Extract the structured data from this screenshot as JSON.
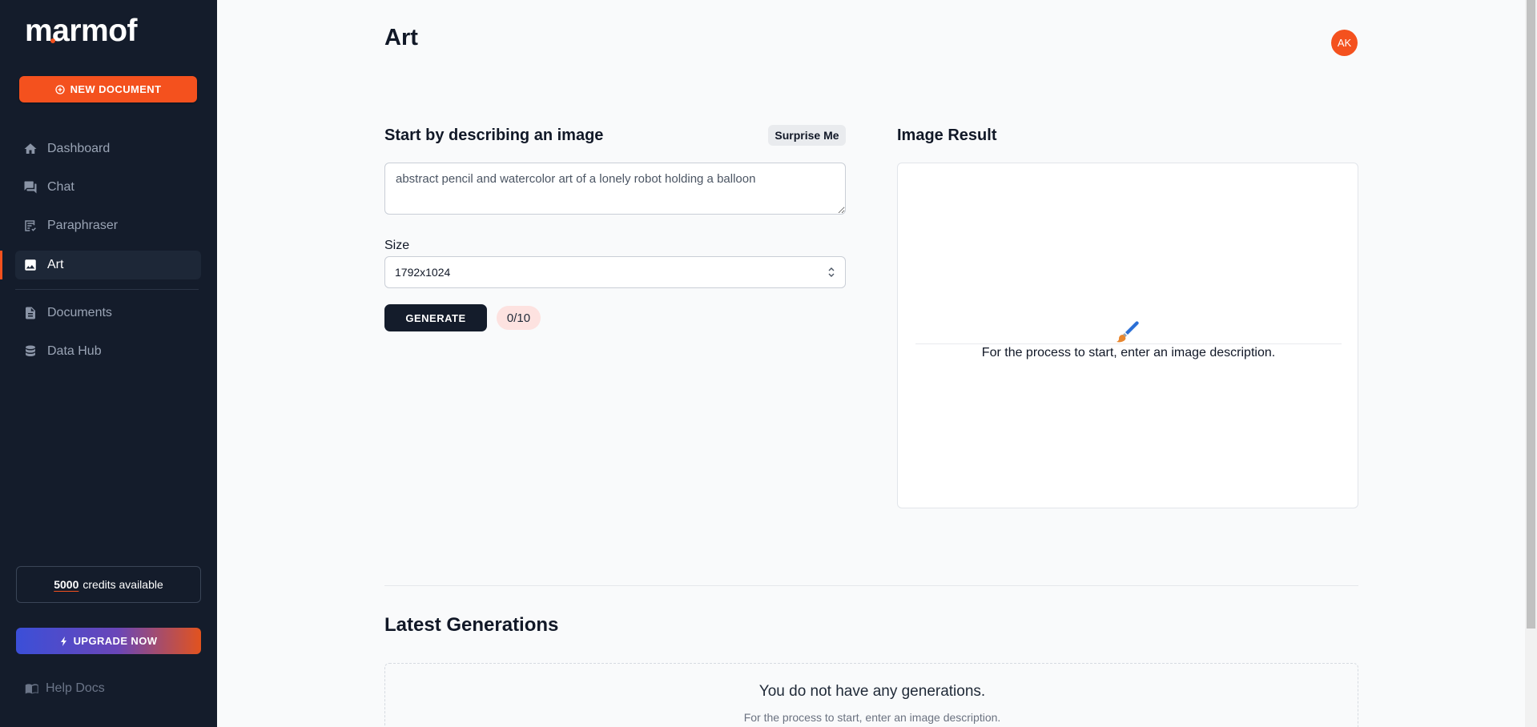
{
  "sidebar": {
    "logo": "marmof",
    "new_document_label": "NEW DOCUMENT",
    "nav": [
      {
        "label": "Dashboard",
        "icon": "home-icon"
      },
      {
        "label": "Chat",
        "icon": "chat-icon"
      },
      {
        "label": "Paraphraser",
        "icon": "paraphrase-icon"
      },
      {
        "label": "Art",
        "icon": "image-icon",
        "active": true
      },
      {
        "label": "Documents",
        "icon": "document-icon"
      },
      {
        "label": "Data Hub",
        "icon": "database-icon"
      }
    ],
    "credits_value": "5000",
    "credits_text": "credits available",
    "upgrade_label": "UPGRADE NOW",
    "help_docs_label": "Help Docs"
  },
  "header": {
    "title": "Art",
    "avatar_initials": "AK"
  },
  "form": {
    "heading": "Start by describing an image",
    "surprise_label": "Surprise Me",
    "prompt_value": "abstract pencil and watercolor art of a lonely robot holding a balloon",
    "size_label": "Size",
    "size_value": "1792x1024",
    "generate_label": "GENERATE",
    "usage_count": "0/10"
  },
  "result": {
    "heading": "Image Result",
    "message": "For the process to start, enter an image description."
  },
  "latest": {
    "heading": "Latest Generations",
    "empty_title": "You do not have any generations.",
    "empty_subtitle": "For the process to start, enter an image description."
  },
  "colors": {
    "sidebar_bg": "#141c2b",
    "accent": "#f4511e",
    "page_bg": "#f9fafb"
  }
}
